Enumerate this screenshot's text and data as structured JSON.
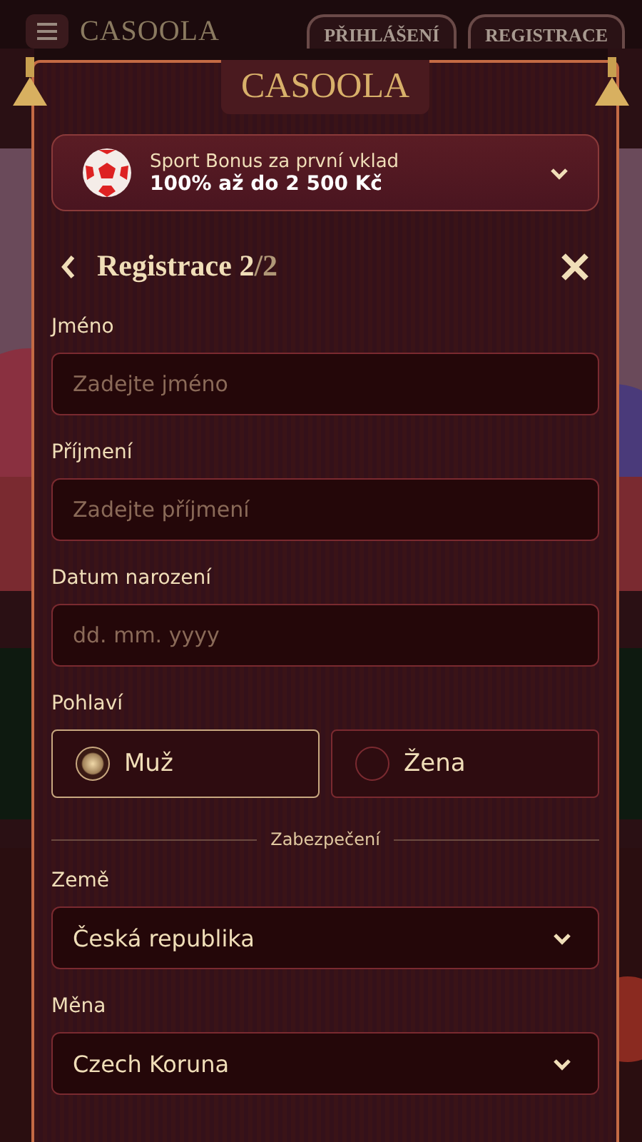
{
  "header": {
    "logo": "CASOOLA",
    "buttons": [
      {
        "label": "PŘIHLÁŠENÍ"
      },
      {
        "label": "REGISTRACE"
      }
    ]
  },
  "modal": {
    "logo": "CASOOLA",
    "bonus": {
      "title": "Sport Bonus za první vklad",
      "offer": "100% až do 2 500 Kč",
      "expanded": false
    },
    "heading": {
      "title": "Registrace",
      "step": "2",
      "of": "/2"
    },
    "fields": [
      {
        "kind": "text",
        "label": "Jméno",
        "placeholder": "Zadejte jméno"
      },
      {
        "kind": "text",
        "label": "Příjmení",
        "placeholder": "Zadejte příjmení"
      },
      {
        "kind": "text",
        "label": "Datum narození",
        "placeholder": "dd. mm. yyyy"
      },
      {
        "kind": "radio",
        "label": "Pohlaví",
        "options": [
          {
            "label": "Muž",
            "selected": true
          },
          {
            "label": "Žena",
            "selected": false
          }
        ]
      },
      {
        "kind": "divider",
        "label": "Zabezpečení"
      },
      {
        "kind": "select",
        "label": "Země",
        "value": "Česká republika"
      },
      {
        "kind": "select",
        "label": "Měna",
        "value": "Czech Koruna"
      }
    ]
  }
}
